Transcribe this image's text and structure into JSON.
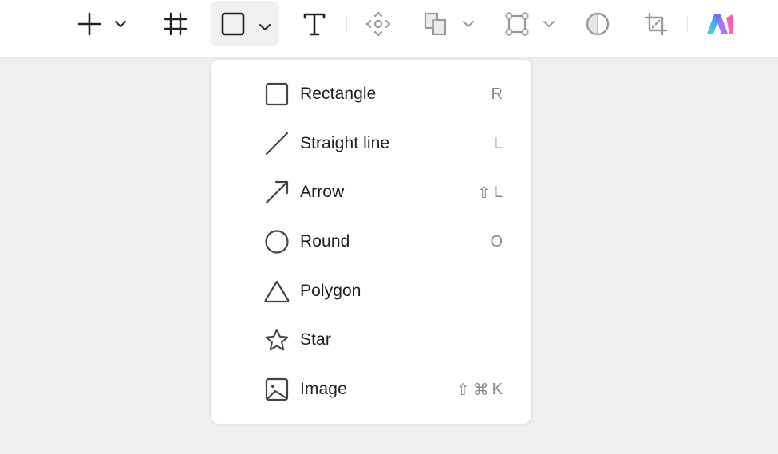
{
  "toolbar": {
    "items": [
      {
        "name": "add",
        "icon": "plus-icon",
        "has_dropdown": true
      },
      {
        "name": "frame",
        "icon": "frame-icon",
        "has_dropdown": false
      },
      {
        "name": "shape",
        "icon": "rectangle-icon",
        "has_dropdown": true,
        "active": true
      },
      {
        "name": "text",
        "icon": "text-icon",
        "has_dropdown": false
      },
      {
        "name": "component",
        "icon": "component-move-icon",
        "has_dropdown": false
      },
      {
        "name": "boolean",
        "icon": "boolean-union-icon",
        "has_dropdown": true
      },
      {
        "name": "vector",
        "icon": "vector-path-icon",
        "has_dropdown": true
      },
      {
        "name": "mask",
        "icon": "mask-icon",
        "has_dropdown": false
      },
      {
        "name": "crop",
        "icon": "crop-icon",
        "has_dropdown": false
      },
      {
        "name": "ai",
        "icon": "ai-logo-icon",
        "has_dropdown": false
      }
    ]
  },
  "shape_menu": {
    "items": [
      {
        "label": "Rectangle",
        "shortcut": "R",
        "icon": "rectangle-icon"
      },
      {
        "label": "Straight line",
        "shortcut": "L",
        "icon": "line-icon"
      },
      {
        "label": "Arrow",
        "shortcut_modifiers": [
          "⇧"
        ],
        "shortcut": "L",
        "icon": "arrow-icon"
      },
      {
        "label": "Round",
        "shortcut": "O",
        "icon": "circle-icon"
      },
      {
        "label": "Polygon",
        "shortcut": "",
        "icon": "polygon-icon"
      },
      {
        "label": "Star",
        "shortcut": "",
        "icon": "star-icon"
      },
      {
        "label": "Image",
        "shortcut_modifiers": [
          "⇧",
          "⌘"
        ],
        "shortcut": "K",
        "icon": "image-icon"
      }
    ]
  },
  "colors": {
    "toolbar_bg": "#ffffff",
    "canvas_bg": "#efefef",
    "icon_dark": "#222222",
    "icon_muted": "#9a9a9a",
    "shortcut_text": "#8a8a8a"
  }
}
